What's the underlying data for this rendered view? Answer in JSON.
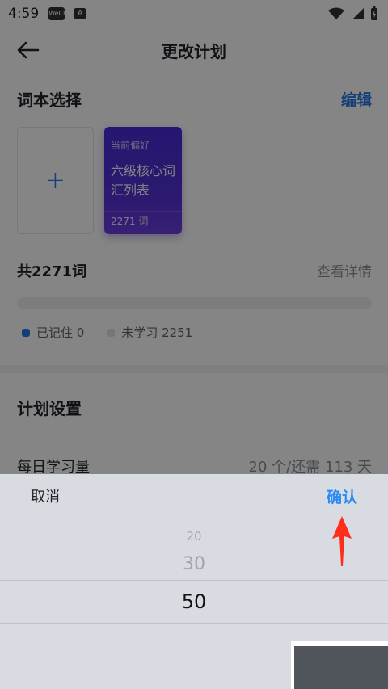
{
  "status_bar": {
    "time": "4:59",
    "app_badge": "WeChat",
    "a_badge": "A"
  },
  "header": {
    "title": "更改计划"
  },
  "wordbook": {
    "section_title": "词本选择",
    "edit_label": "编辑",
    "card": {
      "tag": "当前偏好",
      "name": "六级核心词汇列表",
      "count": "2271 词"
    }
  },
  "summary": {
    "total_prefix": "共",
    "total_number": "2271",
    "total_suffix": "词",
    "detail_link": "查看详情",
    "memorized_label": "已记住 0",
    "unlearned_label": "未学习 2251"
  },
  "plan": {
    "section_title": "计划设置",
    "daily_label": "每日学习量",
    "daily_value": "20 个/还需 113 天"
  },
  "sheet": {
    "cancel_label": "取消",
    "confirm_label": "确认",
    "options": [
      "20",
      "30",
      "50"
    ],
    "selected": "50"
  },
  "colors": {
    "accent": "#2677e6",
    "confirm": "#2b8af0",
    "book_card": "#4a2bd8",
    "annotation_arrow": "#ff2d1a"
  }
}
